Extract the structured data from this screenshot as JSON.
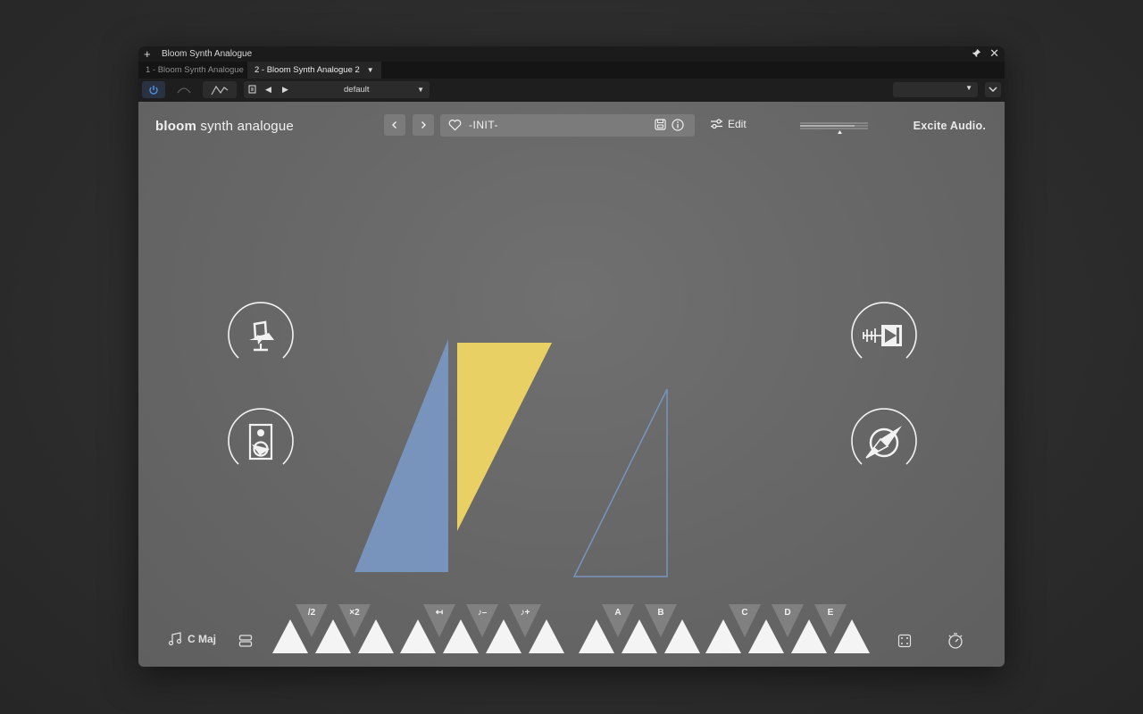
{
  "window": {
    "title": "Bloom Synth Analogue",
    "tabs": [
      {
        "label": "1 - Bloom Synth Analogue",
        "active": false
      },
      {
        "label": "2 - Bloom Synth Analogue 2",
        "active": true
      }
    ]
  },
  "toolbar": {
    "preset_label": "default"
  },
  "plugin": {
    "logo_bold": "bloom",
    "logo_light": "synth analogue",
    "preset_name": "-INIT-",
    "edit_label": "Edit",
    "brand": "Excite Audio.",
    "scale_label": "C Maj",
    "colors": {
      "background": "#6a6a6a",
      "yellow": "#e9d064",
      "blue": "#7894bd",
      "white": "#f4f4f4"
    },
    "icons": {
      "left_top": "microphone-icon",
      "left_bottom": "speaker-icon",
      "right_top": "transient-icon",
      "right_bottom": "compass-icon"
    },
    "bottom_groups": [
      {
        "buttons": [
          {
            "label": ""
          },
          {
            "label": "/2"
          },
          {
            "label": ""
          },
          {
            "label": "×2"
          },
          {
            "label": ""
          }
        ]
      },
      {
        "buttons": [
          {
            "label": ""
          },
          {
            "label": "↤"
          },
          {
            "label": ""
          },
          {
            "label": "♪–"
          },
          {
            "label": ""
          },
          {
            "label": "♪+"
          },
          {
            "label": ""
          }
        ]
      },
      {
        "buttons": [
          {
            "label": ""
          },
          {
            "label": "A"
          },
          {
            "label": ""
          },
          {
            "label": "B"
          },
          {
            "label": ""
          }
        ]
      },
      {
        "buttons": [
          {
            "label": ""
          },
          {
            "label": "C"
          },
          {
            "label": ""
          },
          {
            "label": "D"
          },
          {
            "label": ""
          },
          {
            "label": "E"
          },
          {
            "label": ""
          }
        ]
      }
    ]
  }
}
